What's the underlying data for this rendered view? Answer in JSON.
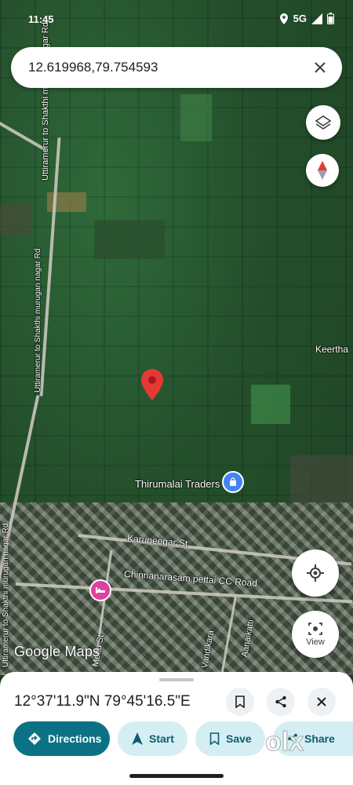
{
  "status": {
    "time": "11:45",
    "network": "5G"
  },
  "search": {
    "query": "12.619968,79.754593"
  },
  "map_labels": {
    "road_vertical_upper": "Uttiramerur to Shakthi murugan nagar Rd",
    "road_vertical_lower": "Uttiramerur to Shakthi murugan nagar Rd",
    "road_vertical_top": "Uttiramerur to Shakthi murugan nagar Rd",
    "poi": "Thirumalai Traders",
    "keertha": "Keertha",
    "karuneegar": "Karuneegar St",
    "chinnanarasam": "Chinnanarasam pettai CC Road",
    "mettu": "Mettu St",
    "vandikara": "Vandikara",
    "aanaikatti": "Aanaikatti",
    "google_maps": "Google Maps"
  },
  "buttons": {
    "view": "View"
  },
  "sheet": {
    "coords": "12°37'11.9\"N 79°45'16.5\"E",
    "directions": "Directions",
    "start": "Start",
    "save": "Save",
    "share": "Share"
  },
  "watermark": "olx",
  "colors": {
    "primary": "#0b7285",
    "secondary_bg": "#d5eef3",
    "pin": "#e53935",
    "poi": "#4285f4",
    "hotel": "#e040a0"
  },
  "icons": [
    "location-icon",
    "signal-icon",
    "battery-icon",
    "close-icon",
    "layers-icon",
    "compass-icon",
    "pin-icon",
    "shopping-bag-icon",
    "hotel-icon",
    "my-location-icon",
    "view-icon",
    "bookmark-icon",
    "share-icon",
    "directions-icon",
    "navigation-icon"
  ]
}
